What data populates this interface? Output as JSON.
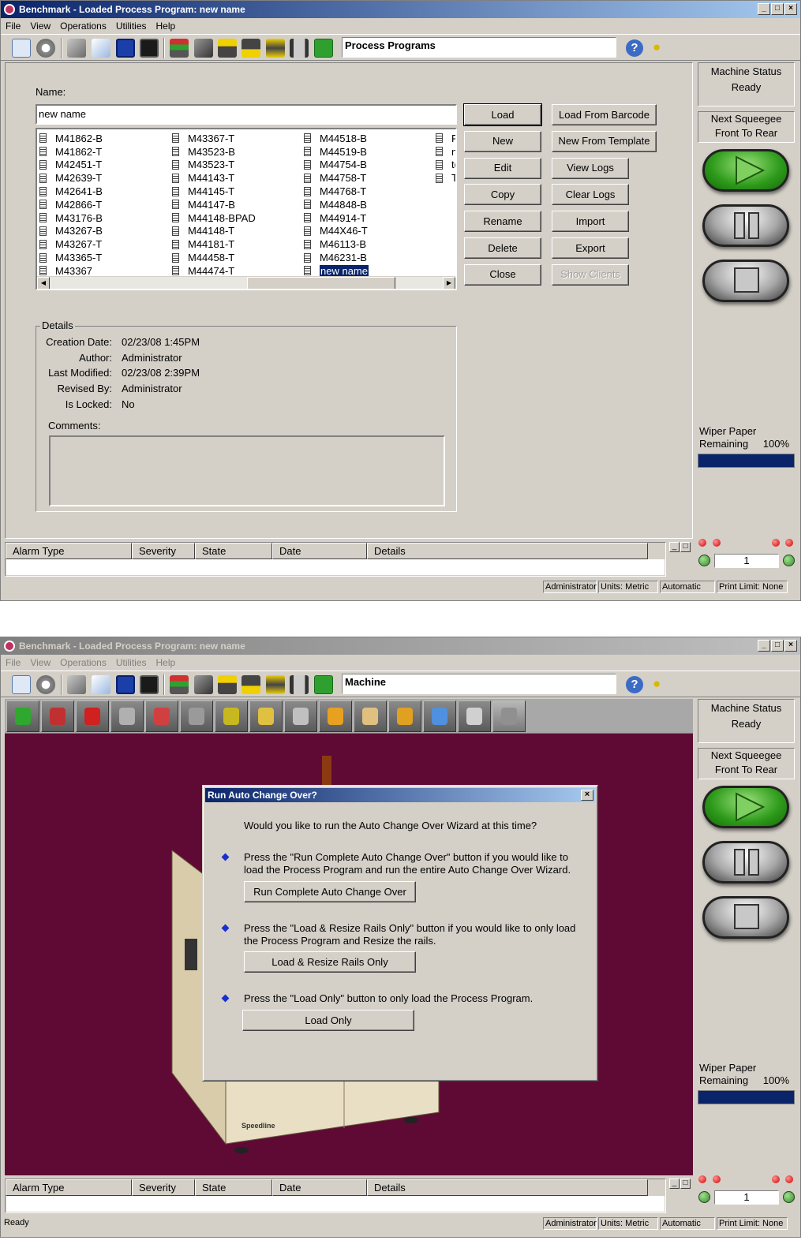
{
  "app": {
    "title": "Benchmark - Loaded Process Program:  new name",
    "menu": [
      "File",
      "View",
      "Operations",
      "Utilities",
      "Help"
    ],
    "window_buttons": {
      "minimize": "_",
      "maximize": "□",
      "close": "×"
    }
  },
  "screen1": {
    "mode": "Process Programs",
    "name_label": "Name:",
    "name_value": "new name",
    "programs": [
      [
        "M41862-B",
        "M41862-T",
        "M42451-T",
        "M42639-T",
        "M42641-B",
        "M42866-T",
        "M43176-B",
        "M43267-B",
        "M43267-T",
        "M43365-T",
        "M43367"
      ],
      [
        "M43367-T",
        "M43523-B",
        "M43523-T",
        "M44143-T",
        "M44145-T",
        "M44147-B",
        "M44148-BPAD",
        "M44148-T",
        "M44181-T",
        "M44458-T",
        "M44474-T"
      ],
      [
        "M44518-B",
        "M44519-B",
        "M44754-B",
        "M44758-T",
        "M44768-T",
        "M44848-B",
        "M44914-T",
        "M44X46-T",
        "M46113-B",
        "M46231-B",
        "new name"
      ],
      [
        "F",
        "n",
        "te",
        "T"
      ]
    ],
    "selected_program": "new name",
    "buttons_left": [
      "Load",
      "New",
      "Edit",
      "Copy",
      "Rename",
      "Delete",
      "Close"
    ],
    "buttons_right": [
      "Load From Barcode",
      "New From Template",
      "View Logs",
      "Clear Logs",
      "Import",
      "Export",
      "Show Clients"
    ],
    "details": {
      "legend": "Details",
      "rows": [
        {
          "k": "Creation Date:",
          "v": "02/23/08 1:45PM"
        },
        {
          "k": "Author:",
          "v": "Administrator"
        },
        {
          "k": "Last Modified:",
          "v": "02/23/08 2:39PM"
        },
        {
          "k": "Revised By:",
          "v": "Administrator"
        },
        {
          "k": "Is Locked:",
          "v": "No"
        }
      ],
      "comments_label": "Comments:"
    }
  },
  "screen2": {
    "mode": "Machine",
    "statusbar_left": "Ready",
    "dialog": {
      "title": "Run Auto Change Over?",
      "question": "Would you like to run the Auto Change Over Wizard at this time?",
      "option1_text": "Press the \"Run Complete Auto Change Over\" button if you would like to load the Process Program and run the entire Auto Change Over Wizard.",
      "option1_button": "Run Complete Auto Change Over",
      "option2_text": "Press the \"Load & Resize Rails Only\" button  if you would like to only load the Process Program and Resize the rails.",
      "option2_button": "Load & Resize Rails Only",
      "option3_text": "Press the \"Load Only\" button to only load the Process Program.",
      "option3_button": "Load Only"
    },
    "machine_brand": "Speedline"
  },
  "side_panel": {
    "machine_status_label": "Machine Status",
    "machine_status_value": "Ready",
    "next_squeegee_label": "Next Squeegee",
    "next_squeegee_value": "Front To Rear",
    "wiper_label": "Wiper Paper",
    "wiper_remaining_label": "Remaining",
    "wiper_percent": "100%",
    "wiper_level": 1.0,
    "counter": "1"
  },
  "alarm_columns": [
    "Alarm Type",
    "Severity",
    "State",
    "Date",
    "Details"
  ],
  "statusbar": {
    "user": "Administrator",
    "units": "Units: Metric",
    "mode": "Automatic",
    "print_limit": "Print Limit: None"
  },
  "icons": {
    "toolbar": [
      "home-icon",
      "back-icon",
      "open-folder-icon",
      "notepad-icon",
      "save-icon",
      "save-all-icon",
      "board-icon",
      "camera-icon",
      "raise-icon",
      "lower-icon",
      "updown-icon",
      "tower-icon",
      "lock-icon"
    ],
    "machine_bar": [
      "refresh-icon",
      "stencil-icon",
      "screwdriver-icon",
      "book-icon",
      "graph-icon",
      "squeegee-icon",
      "blade-icon",
      "wipe-icon",
      "tool-icon",
      "board-load-icon",
      "paste-icon",
      "transfer-icon",
      "drops-icon",
      "vision-icon",
      "magnet-icon"
    ]
  }
}
